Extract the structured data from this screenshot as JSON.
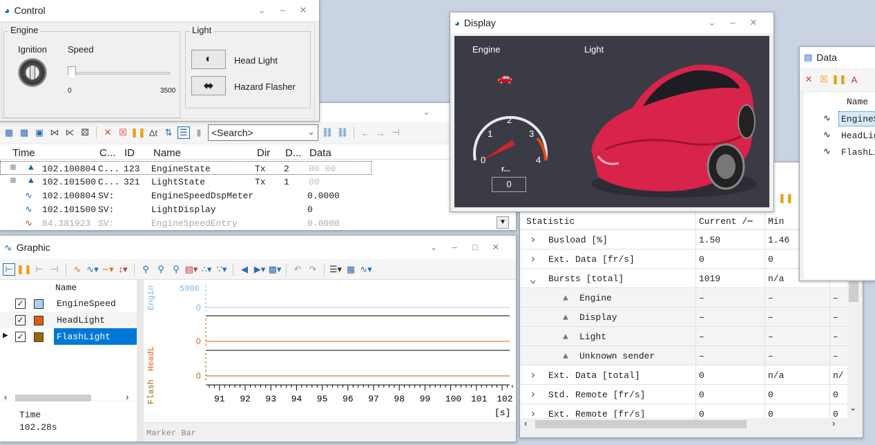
{
  "control": {
    "title": "Control",
    "engine_group": "Engine",
    "light_group": "Light",
    "ignition_label": "Ignition",
    "speed_label": "Speed",
    "slider_min": "0",
    "slider_max": "3500",
    "head_light": "Head Light",
    "hazard_flasher": "Hazard Flasher"
  },
  "measurement": {
    "search_placeholder": "<Search>",
    "columns": [
      "Time",
      "C...",
      "ID",
      "Name",
      "Dir",
      "D...",
      "Data"
    ],
    "rows": [
      {
        "time": "102.100804",
        "ch": "C...",
        "id": "123",
        "name": "EngineState",
        "dir": "Tx",
        "dlc": "2",
        "data": "00 00"
      },
      {
        "time": "102.101500",
        "ch": "C...",
        "id": "321",
        "name": "LightState",
        "dir": "Tx",
        "dlc": "1",
        "data": "00"
      },
      {
        "time": "102.100804",
        "ch": "SV:",
        "id": "",
        "name": "EngineSpeedDspMeter",
        "dir": "",
        "dlc": "",
        "data": "0.0000"
      },
      {
        "time": "102.101500",
        "ch": "SV:",
        "id": "",
        "name": "LightDisplay",
        "dir": "",
        "dlc": "",
        "data": "0"
      },
      {
        "time": "84.381923",
        "ch": "SV:",
        "id": "",
        "name": "EngineSpeedEntry",
        "dir": "",
        "dlc": "",
        "data": "0.0000"
      }
    ]
  },
  "graphic": {
    "title": "Graphic",
    "name_header": "Name",
    "signals": [
      {
        "name": "EngineSpeed",
        "color": "#7db4e6"
      },
      {
        "name": "HeadLight",
        "color": "#e05a10"
      },
      {
        "name": "FlashLight",
        "color": "#9a6a00"
      }
    ],
    "axis_labels": [
      "Engin",
      "HeadL",
      "Flash"
    ],
    "y_tick_top": "5000",
    "zero": "0",
    "x_ticks": [
      "91",
      "92",
      "93",
      "94",
      "95",
      "96",
      "97",
      "98",
      "99",
      "100",
      "101",
      "102"
    ],
    "x_unit": "[s]",
    "time_label": "Time",
    "time_value": "102.28s",
    "marker_bar": "Marker Bar"
  },
  "display": {
    "title": "Display",
    "engine_label": "Engine",
    "light_label": "Light",
    "gauge_ticks": [
      "0",
      "1",
      "2",
      "3",
      "4"
    ],
    "gauge_unit": "r...",
    "gauge_value": "0"
  },
  "statistics": {
    "columns": [
      "Statistic",
      "Current /⋯",
      "Min"
    ],
    "rows": [
      {
        "name": "Busload [%]",
        "current": "1.50",
        "min": "1.46",
        "extra": "",
        "expand": "›",
        "indent": 0
      },
      {
        "name": "Ext. Data [fr/s]",
        "current": "0",
        "min": "0",
        "extra": "",
        "expand": "›",
        "indent": 0
      },
      {
        "name": "Bursts [total]",
        "current": "1019",
        "min": "n/a",
        "extra": "",
        "expand": "⌄",
        "indent": 0
      },
      {
        "name": "Engine",
        "current": "–",
        "min": "–",
        "extra": "–",
        "expand": "",
        "indent": 1
      },
      {
        "name": "Display",
        "current": "–",
        "min": "–",
        "extra": "–",
        "expand": "",
        "indent": 1
      },
      {
        "name": "Light",
        "current": "–",
        "min": "–",
        "extra": "–",
        "expand": "",
        "indent": 1
      },
      {
        "name": "Unknown sender",
        "current": "–",
        "min": "–",
        "extra": "–",
        "expand": "",
        "indent": 1
      },
      {
        "name": "Ext. Data [total]",
        "current": "0",
        "min": "n/a",
        "extra": "n/",
        "expand": "›",
        "indent": 0
      },
      {
        "name": "Std. Remote [fr/s]",
        "current": "0",
        "min": "0",
        "extra": "0",
        "expand": "›",
        "indent": 0
      },
      {
        "name": "Ext. Remote [fr/s]",
        "current": "0",
        "min": "0",
        "extra": "0",
        "expand": "›",
        "indent": 0
      }
    ]
  },
  "data_window": {
    "title": "Data",
    "name_header": "Name",
    "items": [
      "EngineS",
      "HeadLig",
      "FlashLi"
    ]
  },
  "colors": {
    "accent": "#0078d7",
    "display_bg": "#3a3b45",
    "car": "#d8234a",
    "pause": "#f39c12",
    "delete": "#e53935"
  }
}
